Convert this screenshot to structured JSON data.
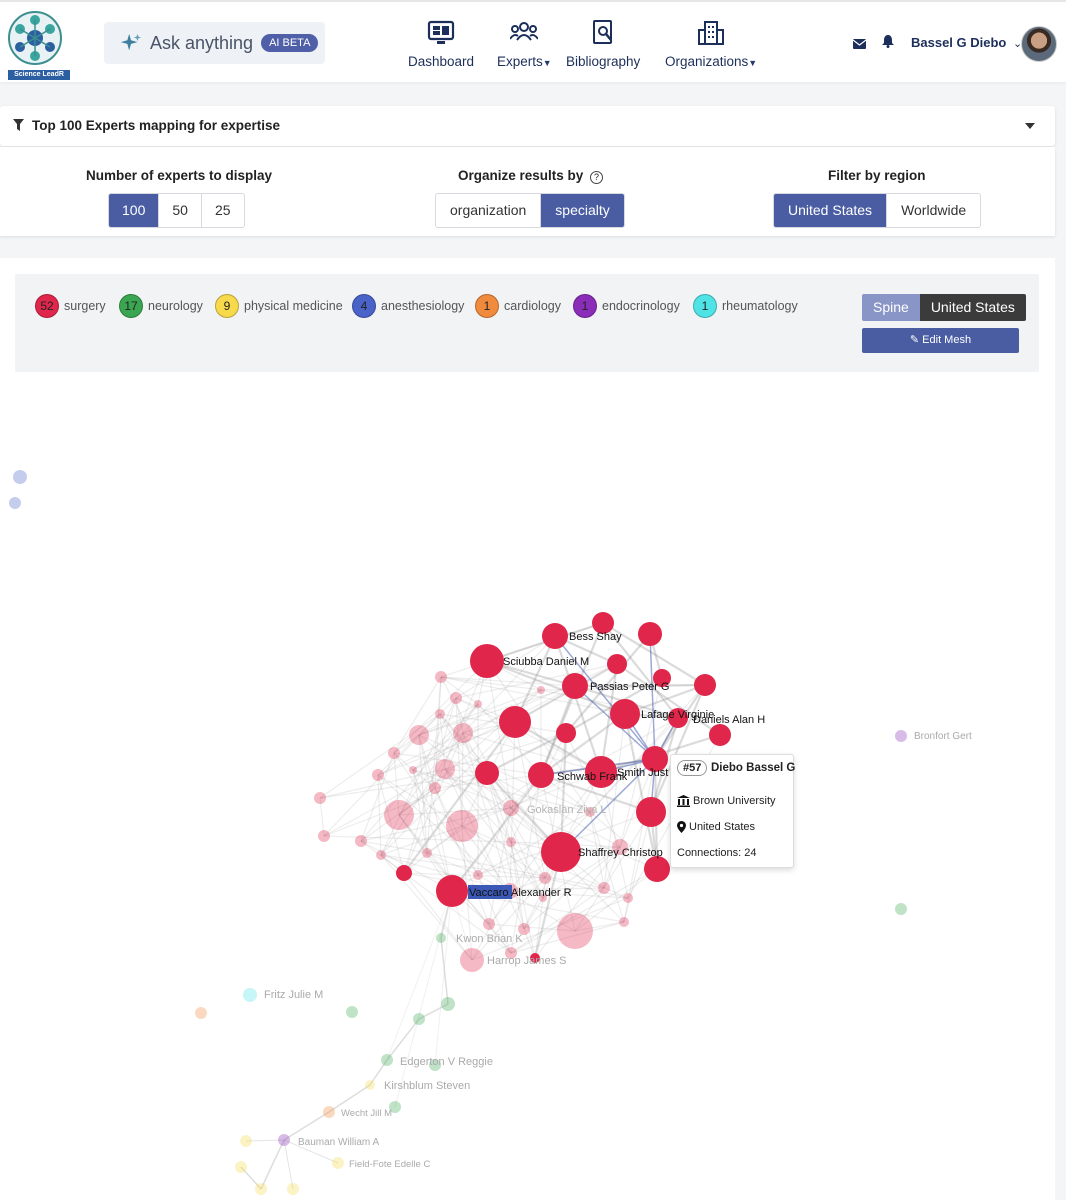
{
  "app": {
    "logo_text": "Science LeadR"
  },
  "header": {
    "ask_label": "Ask anything",
    "ask_badge": "AI BETA",
    "nav": [
      {
        "label": "Dashboard",
        "icon": "dashboard-icon"
      },
      {
        "label": "Experts",
        "icon": "experts-icon"
      },
      {
        "label": "Bibliography",
        "icon": "bibliography-icon"
      },
      {
        "label": "Organizations",
        "icon": "organizations-icon"
      }
    ],
    "user_name": "Bassel G Diebo"
  },
  "filter": {
    "title": "Top 100 Experts mapping for expertise"
  },
  "options": {
    "count_label": "Number of experts to display",
    "count_options": [
      "100",
      "50",
      "25"
    ],
    "count_selected": "100",
    "organize_label": "Organize results by",
    "organize_options": [
      "organization",
      "specialty"
    ],
    "organize_selected": "specialty",
    "region_label": "Filter by region",
    "region_options": [
      "United States",
      "Worldwide"
    ],
    "region_selected": "United States"
  },
  "legend": [
    {
      "count": "52",
      "label": "surgery",
      "color": "#e0264a"
    },
    {
      "count": "17",
      "label": "neurology",
      "color": "#3aa651"
    },
    {
      "count": "9",
      "label": "physical medicine",
      "color": "#f7d94c"
    },
    {
      "count": "4",
      "label": "anesthesiology",
      "color": "#4a63c8"
    },
    {
      "count": "1",
      "label": "cardiology",
      "color": "#f08a3c"
    },
    {
      "count": "1",
      "label": "endocrinology",
      "color": "#8a2db8"
    },
    {
      "count": "1",
      "label": "rheumatology",
      "color": "#4fe3e6"
    }
  ],
  "scope": {
    "topic": "Spine",
    "region": "United States",
    "edit_label": "Edit Mesh"
  },
  "graph_labels": [
    "Bess Shay",
    "Sciubba Daniel M",
    "Passias Peter G",
    "Lafage Virginie",
    "Daniels Alan H",
    "Smith Just",
    "Schwab Frank",
    "Gokaslan Ziya L",
    "Shaffrey Christop",
    "Vaccaro Alexander R",
    "Kwon Brian K",
    "Harrop James S",
    "Bronfort Gert",
    "Fritz Julie M",
    "Edgerton V Reggie",
    "Kirshblum Steven",
    "Wecht Jill M",
    "Bauman William A",
    "Field-Fote Edelle C"
  ],
  "tooltip": {
    "rank": "#57",
    "name": "Diebo Bassel G",
    "organization": "Brown University",
    "country": "United States",
    "connections": "Connections: 24"
  }
}
